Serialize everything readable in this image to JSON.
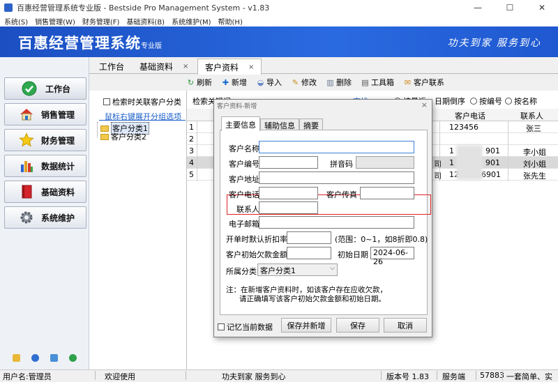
{
  "window": {
    "title": "百惠经营管理系统专业版 - Bestside Pro Management System - v1.83",
    "controls": [
      "—",
      "☐",
      "✕"
    ]
  },
  "menu": [
    "系统(S)",
    "销售管理(W)",
    "财务管理(F)",
    "基础资料(B)",
    "系统维护(M)",
    "帮助(H)"
  ],
  "banner": {
    "brand": "百惠经营管理系统",
    "edition": "专业版",
    "slogan": "功夫到家 服务到心"
  },
  "nav": [
    {
      "label": "工作台",
      "icon": "check-icon"
    },
    {
      "label": "销售管理",
      "icon": "house-icon"
    },
    {
      "label": "财务管理",
      "icon": "star-icon"
    },
    {
      "label": "数据统计",
      "icon": "bar-chart-icon"
    },
    {
      "label": "基础资料",
      "icon": "book-icon"
    },
    {
      "label": "系统维护",
      "icon": "gear-icon"
    }
  ],
  "tabs": [
    {
      "label": "工作台"
    },
    {
      "label": "基础资料",
      "close": "×"
    },
    {
      "label": "客户资料",
      "close": "×"
    }
  ],
  "toolbar": {
    "refresh": "刷新",
    "add": "新增",
    "import": "导入",
    "edit": "修改",
    "delete": "删除",
    "toolbox": "工具箱",
    "contact": "客户联系"
  },
  "tree": {
    "checkbox_label": "检索时关联客户分类",
    "hint": "鼠标右键展开分组选项",
    "items": [
      "客户分类1",
      "客户分类2"
    ]
  },
  "search": {
    "label": "检索关键词",
    "btn": "查找",
    "radio1": "按最近",
    "radio1_tail": "日期倒序",
    "radio2": "按编号",
    "radio3": "按名称"
  },
  "grid": {
    "col_phone": "客户电话",
    "col_contact": "联系人",
    "row_nums": [
      "1",
      "2",
      "3",
      "4",
      "5"
    ],
    "rows": [
      {
        "mid": "",
        "phone": "123456",
        "contact": "张三"
      },
      {
        "mid": "",
        "phone": "",
        "contact": ""
      },
      {
        "mid": "",
        "phone": "1",
        "phone_tail": "901",
        "contact": "李小姐"
      },
      {
        "mid": "司",
        "phone": "1",
        "phone_tail": "901",
        "contact": "刘小姐"
      },
      {
        "mid": "司",
        "phone": "1234",
        "phone_tail": "6901",
        "contact": "张先生"
      }
    ]
  },
  "status": {
    "user": "用户名:管理员",
    "welcome": "欢迎使用",
    "slogan": "功夫到家 服务到心",
    "version": "版本号 1.83",
    "server_label": "服务端",
    "port": "57883",
    "tail": "一套简单、实"
  },
  "dialog": {
    "title": "客户资料-新增",
    "close": "×",
    "tabs": [
      "主要信息",
      "辅助信息",
      "摘要"
    ],
    "labels": {
      "name": "客户名称",
      "code": "客户编号",
      "pinyin": "拼音码",
      "address": "客户地址",
      "phone": "客户电话",
      "fax": "客户传真",
      "contact": "联系人",
      "email": "电子邮箱",
      "discount": "开单时默认折扣率",
      "discount_hint": "(范围：0~1，如8折即0.8)",
      "debt": "客户初始欠款金额",
      "init_date": "初始日期",
      "category": "所属分类"
    },
    "values": {
      "name": "",
      "code": "",
      "pinyin": "",
      "address": "",
      "phone": "",
      "fax": "",
      "contact": "",
      "email": "",
      "discount": "",
      "debt": "",
      "init_date": "2024-06-26",
      "category": "客户分类1"
    },
    "note_line1": "注：在新增客户资料时，如该客户存在应收欠款，",
    "note_line2": "请正确填写该客户初始欠款金额和初始日期。",
    "remember": "记忆当前数据",
    "buttons": {
      "save_new": "保存并新增",
      "save": "保存",
      "cancel": "取消"
    }
  },
  "colors": {
    "banner": "#2a6ae0",
    "highlight_box": "#dd2222",
    "link": "#1a5fc8"
  }
}
